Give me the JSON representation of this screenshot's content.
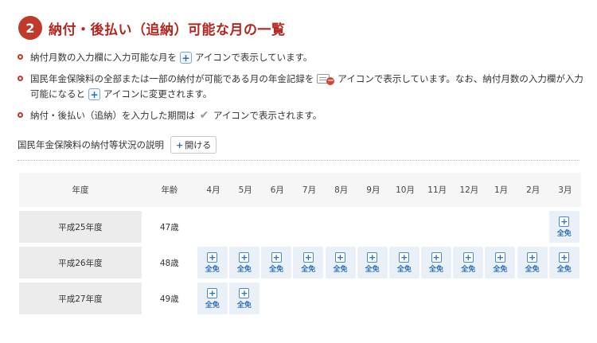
{
  "section": {
    "number": "2",
    "title": "納付・後払い（追納）可能な月の一覧"
  },
  "bullets": {
    "b1": {
      "pre": "納付月数の入力欄に入力可能な月を",
      "post": "アイコンで表示しています。"
    },
    "b2": {
      "pre": "国民年金保険料の全部または一部の納付が可能である月の年金記録を",
      "mid": "アイコンで表示しています。なお、納付月数の入力欄が入力可能になると",
      "post": "アイコンに変更されます。"
    },
    "b3": {
      "pre": "納付・後払い（追納）を入力した期間は",
      "post": "アイコンで表示されます。"
    }
  },
  "explain": {
    "label": "国民年金保険料の納付等状況の説明",
    "button": "開ける"
  },
  "table": {
    "headers": {
      "year": "年度",
      "age": "年齢",
      "months": [
        "4月",
        "5月",
        "6月",
        "7月",
        "8月",
        "9月",
        "10月",
        "11月",
        "12月",
        "1月",
        "2月",
        "3月"
      ]
    },
    "cell_label": "全免",
    "rows": [
      {
        "year": "平成25年度",
        "age": "47歳",
        "active": [
          false,
          false,
          false,
          false,
          false,
          false,
          false,
          false,
          false,
          false,
          false,
          true
        ]
      },
      {
        "year": "平成26年度",
        "age": "48歳",
        "active": [
          true,
          true,
          true,
          true,
          true,
          true,
          true,
          true,
          true,
          true,
          true,
          true
        ]
      },
      {
        "year": "平成27年度",
        "age": "49歳",
        "active": [
          true,
          true,
          false,
          false,
          false,
          false,
          false,
          false,
          false,
          false,
          false,
          false
        ]
      }
    ]
  },
  "colors": {
    "accent": "#c0392b",
    "title": "#b5261e",
    "icon_blue": "#2d6fb7"
  }
}
